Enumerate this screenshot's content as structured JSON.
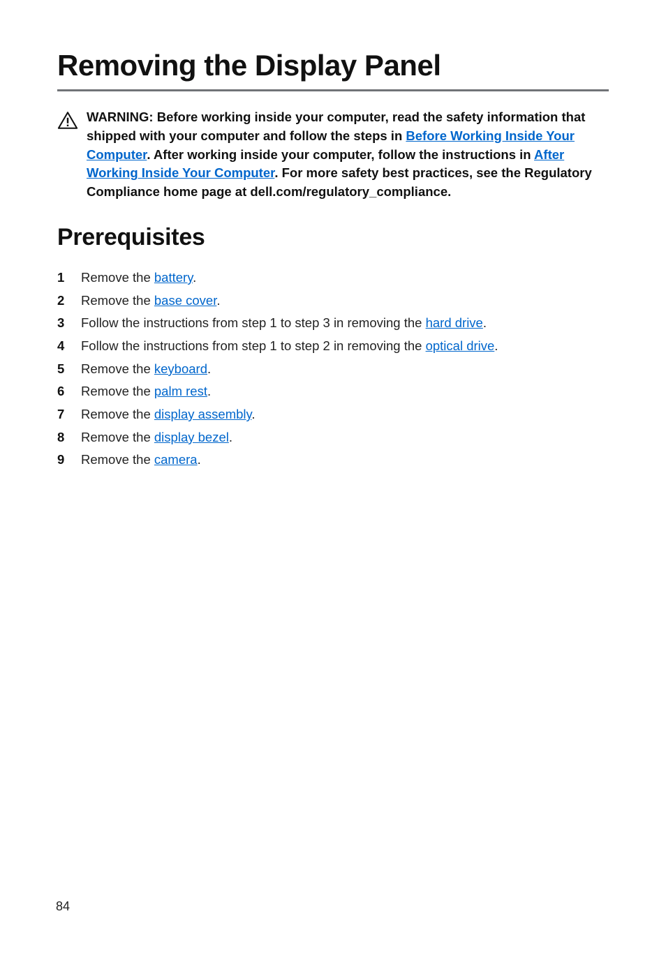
{
  "page_title": "Removing the Display Panel",
  "warning": {
    "text_parts": [
      {
        "t": "WARNING: Before working inside your computer, read the safety information that shipped with your computer and follow the steps in ",
        "link": false
      },
      {
        "t": "Before Working Inside Your Computer",
        "link": true
      },
      {
        "t": ". After working inside your computer, follow the instructions in ",
        "link": false
      },
      {
        "t": "After Working Inside Your Computer",
        "link": true
      },
      {
        "t": ". For more safety best practices, see the Regulatory Compliance home page at dell.com/regulatory_compliance.",
        "link": false
      }
    ]
  },
  "section_heading": "Prerequisites",
  "steps": [
    [
      {
        "t": "Remove the ",
        "link": false
      },
      {
        "t": "battery",
        "link": true
      },
      {
        "t": ".",
        "link": false
      }
    ],
    [
      {
        "t": "Remove the ",
        "link": false
      },
      {
        "t": "base cover",
        "link": true
      },
      {
        "t": ".",
        "link": false
      }
    ],
    [
      {
        "t": "Follow the instructions from step 1 to step 3 in removing the ",
        "link": false
      },
      {
        "t": "hard drive",
        "link": true
      },
      {
        "t": ".",
        "link": false
      }
    ],
    [
      {
        "t": "Follow the instructions from step 1 to step 2 in removing the ",
        "link": false
      },
      {
        "t": "optical drive",
        "link": true
      },
      {
        "t": ".",
        "link": false
      }
    ],
    [
      {
        "t": "Remove the ",
        "link": false
      },
      {
        "t": "keyboard",
        "link": true
      },
      {
        "t": ".",
        "link": false
      }
    ],
    [
      {
        "t": "Remove the ",
        "link": false
      },
      {
        "t": "palm rest",
        "link": true
      },
      {
        "t": ".",
        "link": false
      }
    ],
    [
      {
        "t": "Remove the ",
        "link": false
      },
      {
        "t": "display assembly",
        "link": true
      },
      {
        "t": ".",
        "link": false
      }
    ],
    [
      {
        "t": "Remove the ",
        "link": false
      },
      {
        "t": "display bezel",
        "link": true
      },
      {
        "t": ".",
        "link": false
      }
    ],
    [
      {
        "t": "Remove the ",
        "link": false
      },
      {
        "t": "camera",
        "link": true
      },
      {
        "t": ".",
        "link": false
      }
    ]
  ],
  "page_number": "84"
}
